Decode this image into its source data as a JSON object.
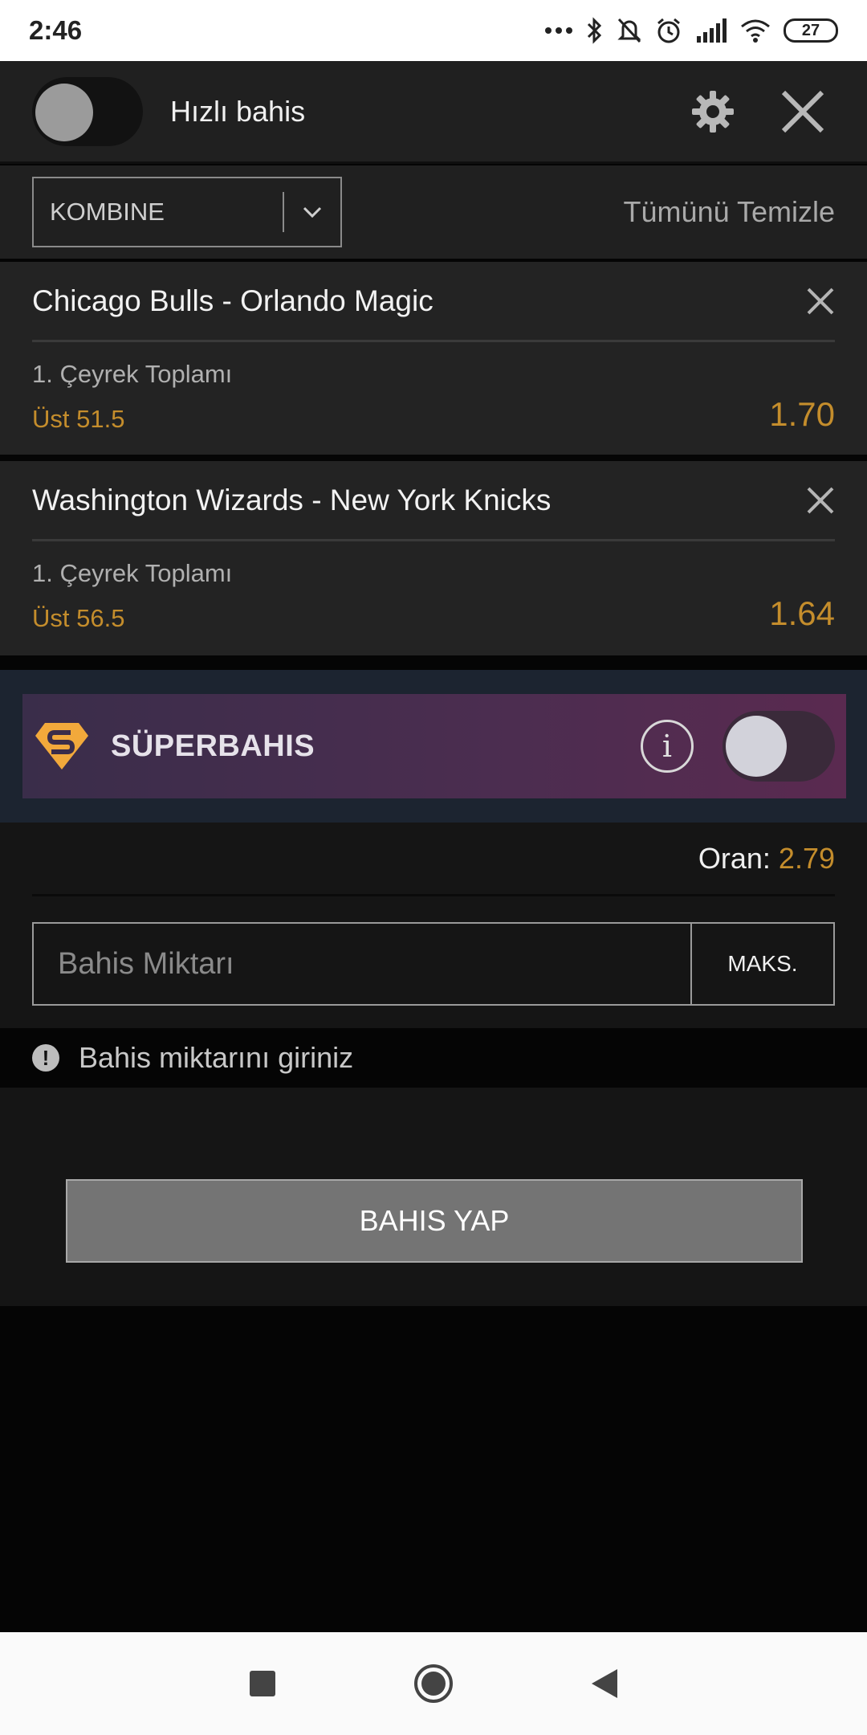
{
  "status_bar": {
    "time": "2:46",
    "battery": "27"
  },
  "header": {
    "quick_bet_label": "Hızlı bahis",
    "quick_bet_on": false
  },
  "mode": {
    "selected": "KOMBINE",
    "clear_all": "Tümünü Temizle"
  },
  "bets": [
    {
      "match": "Chicago Bulls - Orlando Magic",
      "market": "1. Çeyrek Toplamı",
      "selection": "Üst 51.5",
      "odd": "1.70"
    },
    {
      "match": "Washington Wizards - New York Knicks",
      "market": "1. Çeyrek Toplamı",
      "selection": "Üst 56.5",
      "odd": "1.64"
    }
  ],
  "superbahis": {
    "label": "SÜPERBAHIS",
    "info_glyph": "i",
    "enabled": false
  },
  "stake": {
    "oran_label": "Oran:",
    "oran_value": "2.79",
    "amount_placeholder": "Bahis Miktarı",
    "max_label": "MAKS."
  },
  "warning": {
    "icon": "!",
    "text": "Bahis miktarını giriniz"
  },
  "submit": {
    "label": "BAHIS YAP"
  },
  "colors": {
    "accent": "#c48d2c",
    "background": "#202020"
  },
  "icons": [
    "gear-icon",
    "close-icon",
    "chevron-down-icon",
    "info-icon",
    "alert-icon",
    "stop-icon",
    "home-icon",
    "back-icon"
  ]
}
